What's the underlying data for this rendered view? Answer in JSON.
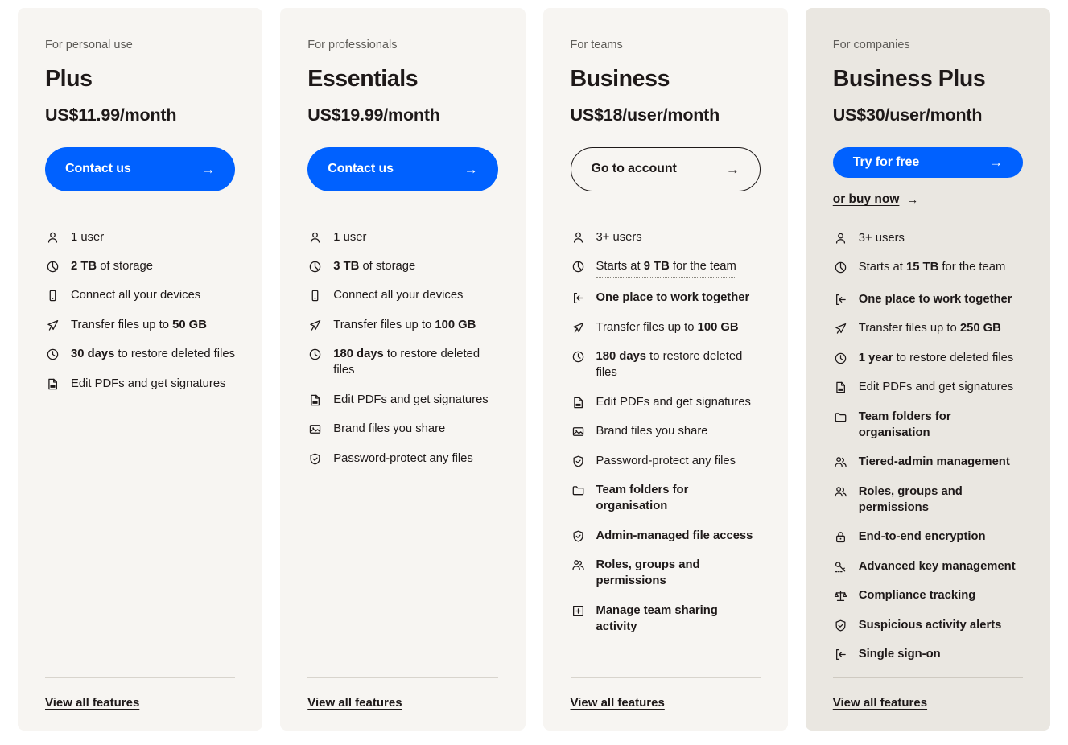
{
  "plans": [
    {
      "eyebrow": "For personal use",
      "name": "Plus",
      "price": "US$11.99/month",
      "cta_label": "Contact us",
      "cta_style": "primary",
      "secondary_link": null,
      "view_all_label": "View all features",
      "features": [
        {
          "icon": "user-icon",
          "pre": "",
          "bold": "",
          "post": "1 user",
          "all_bold": false,
          "tooltip": false
        },
        {
          "icon": "storage-pie-icon",
          "pre": "",
          "bold": "2 TB",
          "post": " of storage",
          "all_bold": false,
          "tooltip": false
        },
        {
          "icon": "device-icon",
          "pre": "",
          "bold": "",
          "post": "Connect all your devices",
          "all_bold": false,
          "tooltip": false
        },
        {
          "icon": "paper-plane-icon",
          "pre": "Transfer files up to ",
          "bold": "50 GB",
          "post": "",
          "all_bold": false,
          "tooltip": false
        },
        {
          "icon": "clock-icon",
          "pre": "",
          "bold": "30 days",
          "post": " to restore deleted files",
          "all_bold": false,
          "tooltip": false
        },
        {
          "icon": "pdf-icon",
          "pre": "",
          "bold": "",
          "post": "Edit PDFs and get signatures",
          "all_bold": false,
          "tooltip": false
        }
      ]
    },
    {
      "eyebrow": "For professionals",
      "name": "Essentials",
      "price": "US$19.99/month",
      "cta_label": "Contact us",
      "cta_style": "primary",
      "secondary_link": null,
      "view_all_label": "View all features",
      "features": [
        {
          "icon": "user-icon",
          "pre": "",
          "bold": "",
          "post": "1 user",
          "all_bold": false,
          "tooltip": false
        },
        {
          "icon": "storage-pie-icon",
          "pre": "",
          "bold": "3 TB",
          "post": " of storage",
          "all_bold": false,
          "tooltip": false
        },
        {
          "icon": "device-icon",
          "pre": "",
          "bold": "",
          "post": "Connect all your devices",
          "all_bold": false,
          "tooltip": false
        },
        {
          "icon": "paper-plane-icon",
          "pre": "Transfer files up to ",
          "bold": "100 GB",
          "post": "",
          "all_bold": false,
          "tooltip": false
        },
        {
          "icon": "clock-icon",
          "pre": "",
          "bold": "180 days",
          "post": " to restore deleted files",
          "all_bold": false,
          "tooltip": false
        },
        {
          "icon": "pdf-icon",
          "pre": "",
          "bold": "",
          "post": "Edit PDFs and get signatures",
          "all_bold": false,
          "tooltip": false
        },
        {
          "icon": "brand-image-icon",
          "pre": "",
          "bold": "",
          "post": "Brand files you share",
          "all_bold": false,
          "tooltip": false
        },
        {
          "icon": "shield-check-icon",
          "pre": "",
          "bold": "",
          "post": "Password-protect any files",
          "all_bold": false,
          "tooltip": false
        }
      ]
    },
    {
      "eyebrow": "For teams",
      "name": "Business",
      "price": "US$18/user/month",
      "cta_label": "Go to account",
      "cta_style": "outline",
      "secondary_link": null,
      "view_all_label": "View all features",
      "features": [
        {
          "icon": "user-icon",
          "pre": "",
          "bold": "",
          "post": "3+ users",
          "all_bold": false,
          "tooltip": false
        },
        {
          "icon": "storage-pie-icon",
          "pre": "Starts at ",
          "bold": "9 TB",
          "post": " for the team",
          "all_bold": false,
          "tooltip": true
        },
        {
          "icon": "sign-in-icon",
          "pre": "",
          "bold": "",
          "post": "One place to work together",
          "all_bold": true,
          "tooltip": false
        },
        {
          "icon": "paper-plane-icon",
          "pre": "Transfer files up to ",
          "bold": "100 GB",
          "post": "",
          "all_bold": false,
          "tooltip": false
        },
        {
          "icon": "clock-icon",
          "pre": "",
          "bold": "180 days",
          "post": " to restore deleted files",
          "all_bold": false,
          "tooltip": false
        },
        {
          "icon": "pdf-icon",
          "pre": "",
          "bold": "",
          "post": "Edit PDFs and get signatures",
          "all_bold": false,
          "tooltip": false
        },
        {
          "icon": "brand-image-icon",
          "pre": "",
          "bold": "",
          "post": "Brand files you share",
          "all_bold": false,
          "tooltip": false
        },
        {
          "icon": "shield-check-icon",
          "pre": "",
          "bold": "",
          "post": "Password-protect any files",
          "all_bold": false,
          "tooltip": false
        },
        {
          "icon": "folder-icon",
          "pre": "",
          "bold": "",
          "post": "Team folders for organisation",
          "all_bold": true,
          "tooltip": false
        },
        {
          "icon": "shield-check-icon",
          "pre": "",
          "bold": "",
          "post": "Admin-managed file access",
          "all_bold": true,
          "tooltip": false
        },
        {
          "icon": "users-roles-icon",
          "pre": "",
          "bold": "",
          "post": "Roles, groups and permissions",
          "all_bold": true,
          "tooltip": false
        },
        {
          "icon": "share-activity-icon",
          "pre": "",
          "bold": "",
          "post": "Manage team sharing activity",
          "all_bold": true,
          "tooltip": false
        }
      ]
    },
    {
      "eyebrow": "For companies",
      "name": "Business Plus",
      "price": "US$30/user/month",
      "cta_label": "Try for free",
      "cta_style": "primary",
      "secondary_link": "or buy now",
      "view_all_label": "View all features",
      "features": [
        {
          "icon": "user-icon",
          "pre": "",
          "bold": "",
          "post": "3+ users",
          "all_bold": false,
          "tooltip": false
        },
        {
          "icon": "storage-pie-icon",
          "pre": "Starts at ",
          "bold": "15 TB",
          "post": " for the team",
          "all_bold": false,
          "tooltip": true
        },
        {
          "icon": "sign-in-icon",
          "pre": "",
          "bold": "",
          "post": "One place to work together",
          "all_bold": true,
          "tooltip": false
        },
        {
          "icon": "paper-plane-icon",
          "pre": "Transfer files up to ",
          "bold": "250 GB",
          "post": "",
          "all_bold": false,
          "tooltip": false
        },
        {
          "icon": "clock-icon",
          "pre": "",
          "bold": "1 year",
          "post": " to restore deleted files",
          "all_bold": false,
          "tooltip": false
        },
        {
          "icon": "pdf-icon",
          "pre": "",
          "bold": "",
          "post": "Edit PDFs and get signatures",
          "all_bold": false,
          "tooltip": false
        },
        {
          "icon": "folder-icon",
          "pre": "",
          "bold": "",
          "post": "Team folders for organisation",
          "all_bold": true,
          "tooltip": false
        },
        {
          "icon": "users-roles-icon",
          "pre": "",
          "bold": "",
          "post": "Tiered-admin management",
          "all_bold": true,
          "tooltip": false
        },
        {
          "icon": "users-roles-icon",
          "pre": "",
          "bold": "",
          "post": "Roles, groups and permissions",
          "all_bold": true,
          "tooltip": false
        },
        {
          "icon": "lock-icon",
          "pre": "",
          "bold": "",
          "post": "End-to-end encryption",
          "all_bold": true,
          "tooltip": false
        },
        {
          "icon": "key-icon",
          "pre": "",
          "bold": "",
          "post": "Advanced key management",
          "all_bold": true,
          "tooltip": false
        },
        {
          "icon": "scales-icon",
          "pre": "",
          "bold": "",
          "post": "Compliance tracking",
          "all_bold": true,
          "tooltip": false
        },
        {
          "icon": "shield-check-icon",
          "pre": "",
          "bold": "",
          "post": "Suspicious activity alerts",
          "all_bold": true,
          "tooltip": false
        },
        {
          "icon": "sign-in-icon",
          "pre": "",
          "bold": "",
          "post": "Single sign-on",
          "all_bold": true,
          "tooltip": false
        }
      ]
    }
  ],
  "icons": {
    "arrow_right": "→"
  },
  "colors": {
    "accent_blue": "#0061ff",
    "card_bg": "#f7f5f2",
    "card_bg_highlight": "#eae7e1",
    "text": "#1e1919",
    "muted_text": "#5f5d59"
  }
}
